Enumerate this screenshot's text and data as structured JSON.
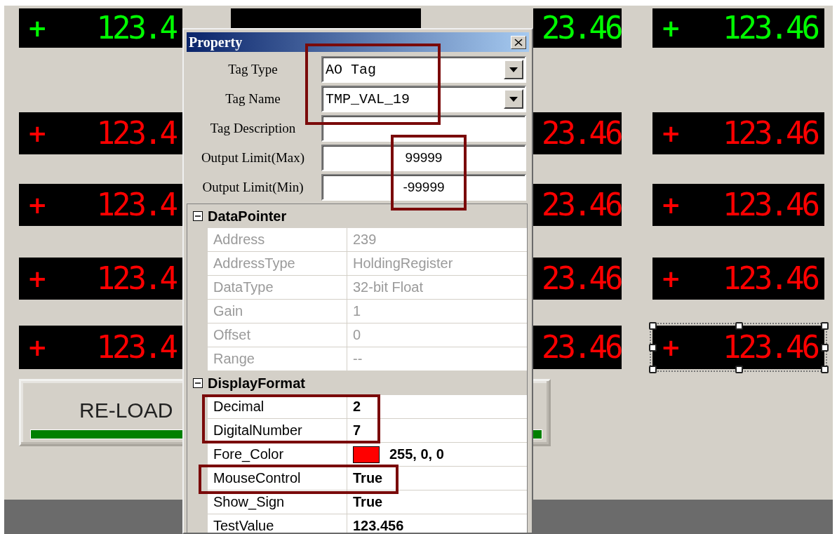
{
  "display_rows": [
    {
      "cells": [
        {
          "sign": "+",
          "value": "123.4",
          "color": "#00ff00",
          "selected": false
        },
        {
          "selected": false
        },
        {
          "value": "23.46",
          "color": "#00ff00",
          "selected": false
        },
        {
          "sign": "+",
          "value": "123.46",
          "color": "#00ff00",
          "selected": false
        }
      ]
    },
    {
      "cells": [
        {
          "sign": "+",
          "value": "123.4",
          "color": "#ff0000",
          "selected": false
        },
        null,
        {
          "value": "23.46",
          "color": "#ff0000",
          "selected": false
        },
        {
          "sign": "+",
          "value": "123.46",
          "color": "#ff0000",
          "selected": false
        }
      ]
    },
    {
      "cells": [
        {
          "sign": "+",
          "value": "123.4",
          "color": "#ff0000",
          "selected": false
        },
        null,
        {
          "value": "23.46",
          "color": "#ff0000",
          "selected": false
        },
        {
          "sign": "+",
          "value": "123.46",
          "color": "#ff0000",
          "selected": false
        }
      ]
    },
    {
      "cells": [
        {
          "sign": "+",
          "value": "123.4",
          "color": "#ff0000",
          "selected": false
        },
        null,
        {
          "value": "23.46",
          "color": "#ff0000",
          "selected": false
        },
        {
          "sign": "+",
          "value": "123.46",
          "color": "#ff0000",
          "selected": false
        }
      ]
    },
    {
      "cells": [
        {
          "sign": "+",
          "value": "123.4",
          "color": "#ff0000",
          "selected": false
        },
        null,
        {
          "value": "23.46",
          "color": "#ff0000",
          "selected": false
        },
        {
          "sign": "+",
          "value": "123.46",
          "color": "#ff0000",
          "selected": true
        }
      ]
    }
  ],
  "reload_button": {
    "label": "RE-LOAD"
  },
  "dialog": {
    "title": "Property",
    "fields": [
      {
        "label": "Tag Type",
        "kind": "combo",
        "value": "AO Tag"
      },
      {
        "label": "Tag Name",
        "kind": "combo",
        "value": "TMP_VAL_19"
      },
      {
        "label": "Tag Description",
        "kind": "text"
      },
      {
        "label": "Output Limit(Max)",
        "kind": "text",
        "value": "99999"
      },
      {
        "label": "Output Limit(Min)",
        "kind": "text",
        "value": "-99999"
      }
    ],
    "categories": [
      {
        "name": "DataPointer",
        "expanded": true,
        "items": [
          {
            "name": "Address",
            "value": "239",
            "disabled": true
          },
          {
            "name": "AddressType",
            "value": "HoldingRegister",
            "disabled": true
          },
          {
            "name": "DataType",
            "value": "32-bit Float",
            "disabled": true
          },
          {
            "name": "Gain",
            "value": "1",
            "disabled": true
          },
          {
            "name": "Offset",
            "value": "0",
            "disabled": true
          },
          {
            "name": "Range",
            "value": "--",
            "disabled": true
          }
        ]
      },
      {
        "name": "DisplayFormat",
        "expanded": true,
        "items": [
          {
            "name": "Decimal",
            "value": "2",
            "disabled": false
          },
          {
            "name": "DigitalNumber",
            "value": "7",
            "disabled": false
          },
          {
            "name": "Fore_Color",
            "value": "255, 0, 0",
            "disabled": false,
            "kind": "color",
            "color": "#ff0000"
          },
          {
            "name": "MouseControl",
            "value": "True",
            "disabled": false
          },
          {
            "name": "Show_Sign",
            "value": "True",
            "disabled": false
          },
          {
            "name": "TestValue",
            "value": "123.456",
            "disabled": false
          }
        ]
      }
    ]
  }
}
